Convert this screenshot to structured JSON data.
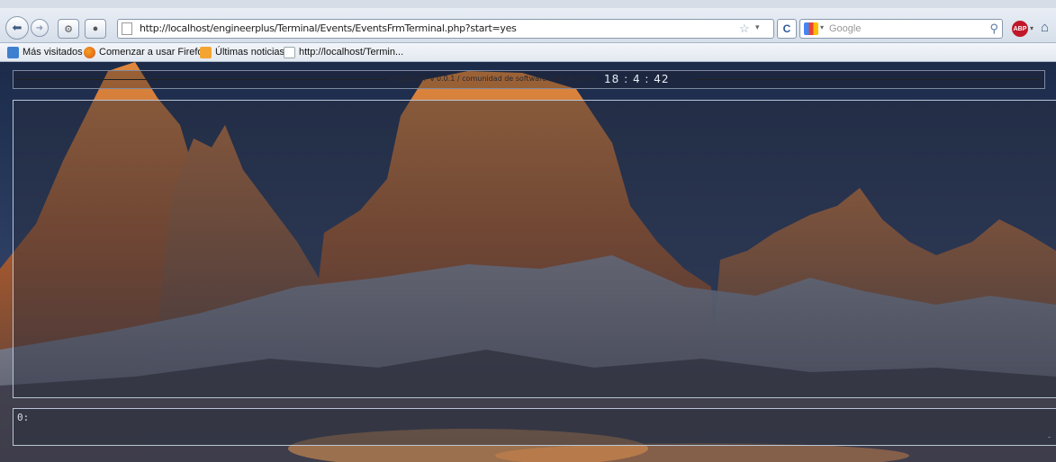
{
  "browser": {
    "url": "http://localhost/engineerplus/Terminal/Events/EventsFrmTerminal.php?start=yes",
    "search_placeholder": "Google",
    "abp_label": "ABP"
  },
  "bookmarks": [
    {
      "label": "Más visitados",
      "icon": "bookmark-blue-icon"
    },
    {
      "label": "Comenzar a usar Firefox",
      "icon": "firefox-icon"
    },
    {
      "label": "Últimas noticias",
      "icon": "rss-icon"
    },
    {
      "label": "http://localhost/Termin...",
      "icon": "page-icon"
    }
  ],
  "terminal": {
    "credit": "engineer+ v 0.0.1 / comunidad de software libre Arco-cel",
    "clock": "18 : 4 : 42",
    "prompt": "0:",
    "caret_hint": "-"
  },
  "colors": {
    "panel_border": "#b9c6d6",
    "clock_text": "#e8eef8",
    "sky": "#1c2b4a"
  }
}
